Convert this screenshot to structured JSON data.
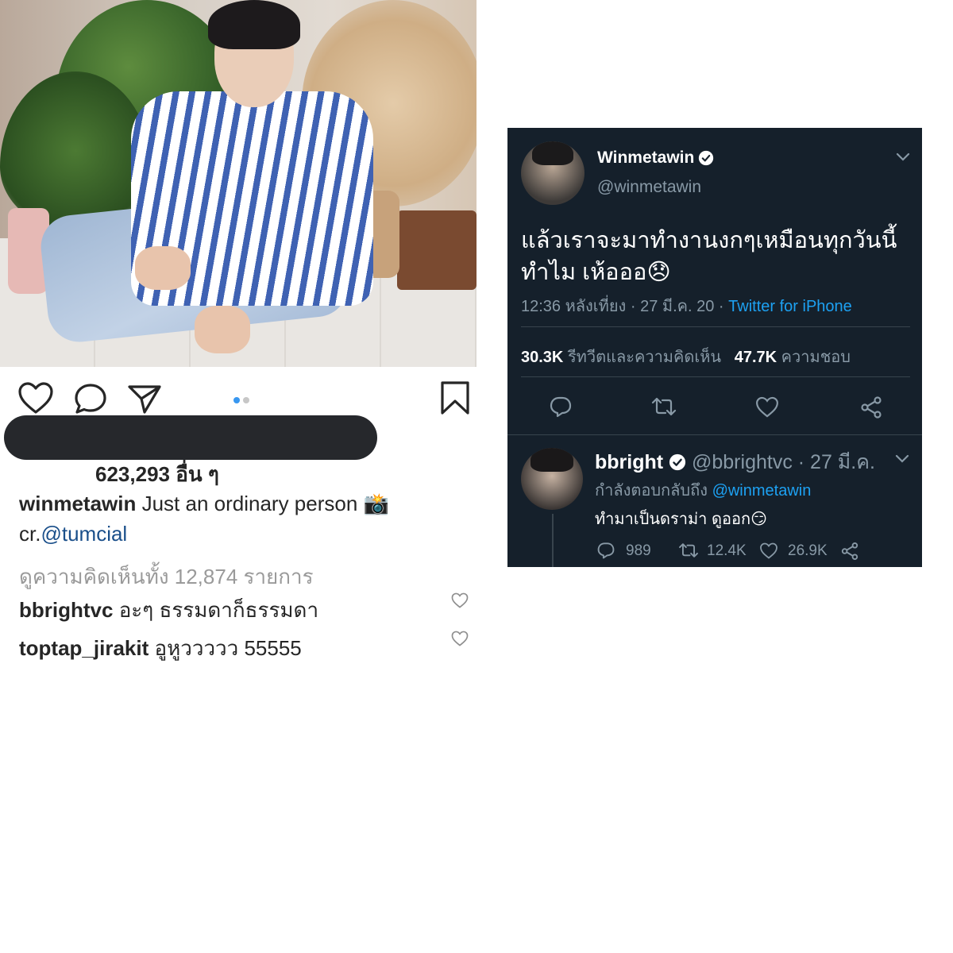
{
  "instagram": {
    "likes_text": "623,293 อื่น ๆ",
    "caption": {
      "username": "winmetawin",
      "text": "Just an ordinary person",
      "emoji": "📸",
      "credit_prefix": "cr.",
      "credit_handle": "@tumcial"
    },
    "view_comments": "ดูความคิดเห็นทั้ง 12,874 รายการ",
    "comments": [
      {
        "username": "bbrightvc",
        "text": "อะๆ ธรรมดาก็ธรรมดา"
      },
      {
        "username": "toptap_jirakit",
        "text": "อูหูววววว 55555"
      }
    ],
    "icons": {
      "like": "heart-outline-icon",
      "comment": "comment-bubble-icon",
      "share": "paper-plane-icon",
      "save": "bookmark-icon"
    },
    "carousel": {
      "count": 2,
      "active": 1,
      "active_color": "#3897f0",
      "inactive_color": "#c7c7c7"
    }
  },
  "twitter": {
    "colors": {
      "background": "#15202b",
      "link": "#1da1f2",
      "muted": "#8899a6",
      "text": "#ffffff"
    },
    "tweet": {
      "display_name": "Winmetawin",
      "handle": "@winmetawin",
      "verified": true,
      "text_line1": "แล้วเราจะมาทำงานงกๆเหมือนทุกวันนี้",
      "text_line2": "ทำไม เห้อออ",
      "emoji": "😞",
      "timestamp": "12:36 หลังเที่ยง · 27 มี.ค. 20 · ",
      "source": "Twitter for iPhone",
      "retweets_count": "30.3K",
      "retweets_label": "รีทวีตและความคิดเห็น",
      "likes_count": "47.7K",
      "likes_label": "ความชอบ"
    },
    "reply": {
      "display_name": "bbright",
      "handle_date": "@bbrightvc · 27 มี.ค.",
      "verified": true,
      "replying_prefix": "กำลังตอบกลับถึง",
      "replying_to": "@winmetawin",
      "text": "ทำมาเป็นดราม่า ดูออก",
      "emoji": "😏",
      "reply_count": "989",
      "retweet_count": "12.4K",
      "like_count": "26.9K"
    }
  }
}
